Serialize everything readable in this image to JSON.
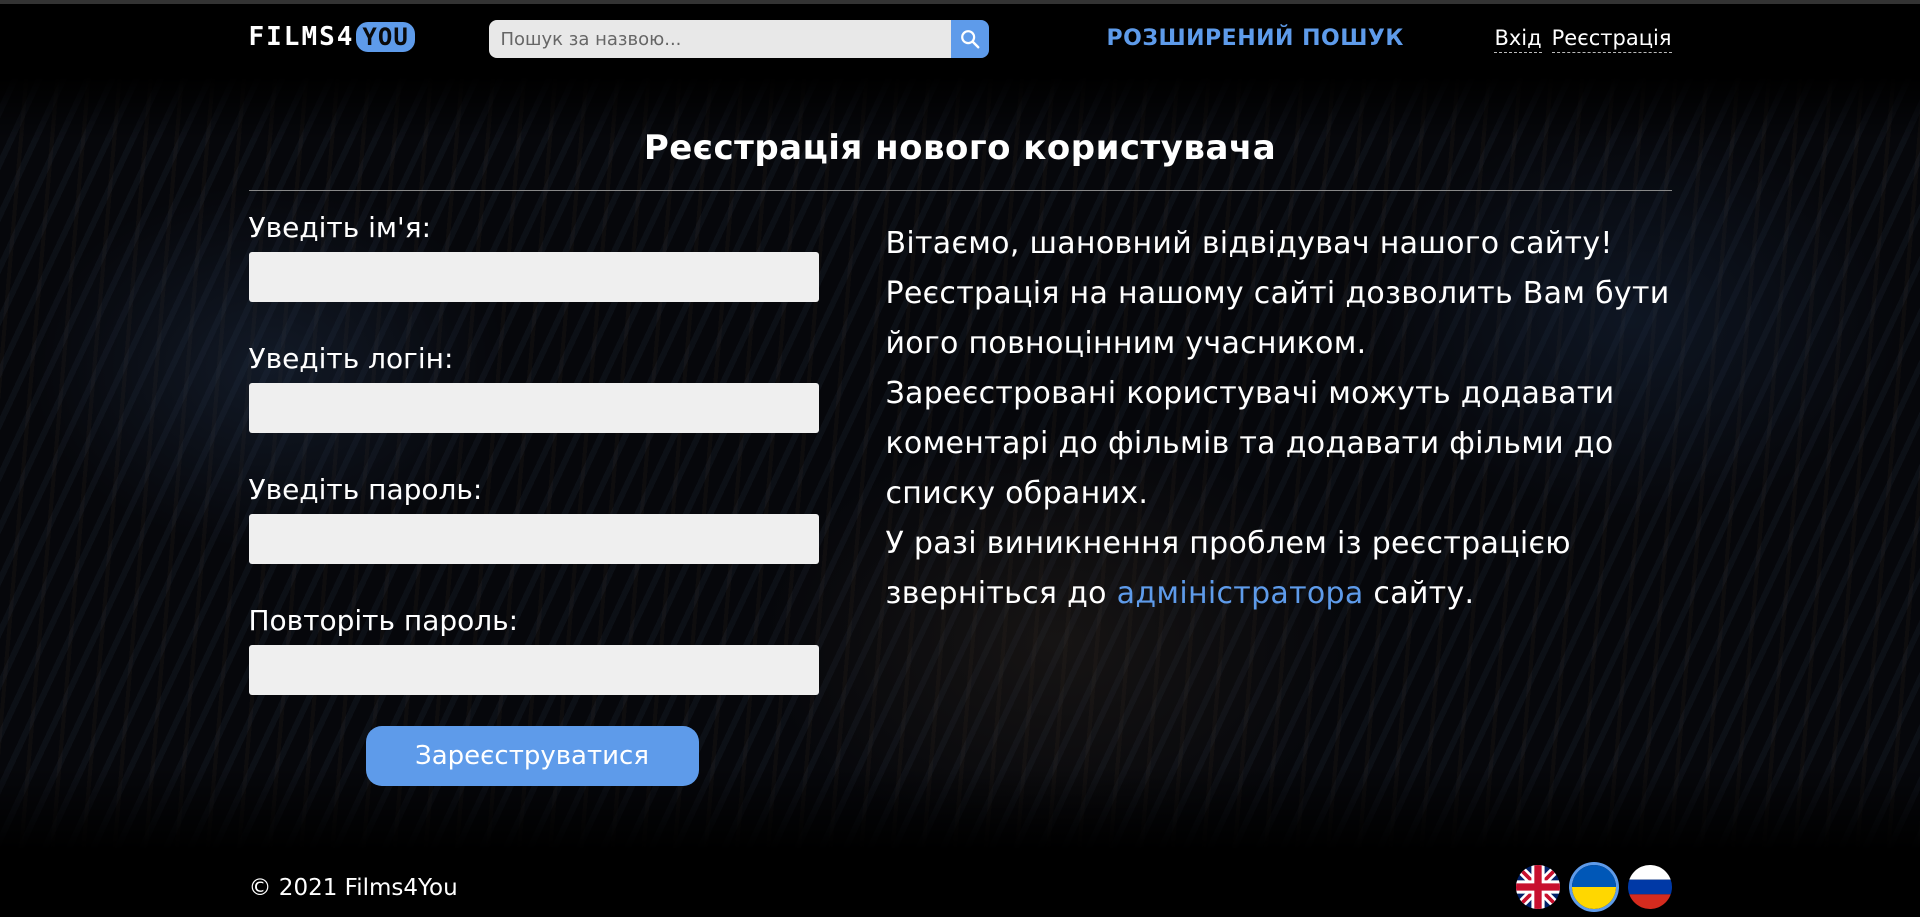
{
  "brand": {
    "logo_main": "FILMS4",
    "logo_accent": "YOU"
  },
  "search": {
    "placeholder": "Пошук за назвою..."
  },
  "nav": {
    "advanced_search": "РОЗШИРЕНИЙ ПОШУК",
    "login": "Вхід",
    "register": "Реєстрація"
  },
  "page": {
    "title": "Реєстрація нового користувача"
  },
  "form": {
    "name_label": "Уведіть ім'я:",
    "login_label": "Уведіть логін:",
    "password_label": "Уведіть пароль:",
    "repeat_password_label": "Повторіть пароль:",
    "submit_label": "Зареєструватися"
  },
  "info": {
    "line1": "Вітаємо, шановний відвідувач нашого сайту!",
    "line2": "Реєстрація на нашому сайті дозволить Вам бути його повноцінним учасником.",
    "line3": "Зареєстровані користувачі можуть додавати коментарі до фільмів та додавати фільми до списку обраних.",
    "line4_before": "У разі виникнення проблем із реєстрацією зверніться до ",
    "line4_link": "адміністратора",
    "line4_after": " сайту."
  },
  "footer": {
    "copyright": "© 2021 Films4You"
  },
  "languages": [
    {
      "icon": "uk-flag-icon",
      "active": false
    },
    {
      "icon": "ua-flag-icon",
      "active": true
    },
    {
      "icon": "ru-flag-icon",
      "active": false
    }
  ],
  "colors": {
    "accent": "#5e9bea",
    "background": "#06070b",
    "input_bg": "#efefef"
  }
}
